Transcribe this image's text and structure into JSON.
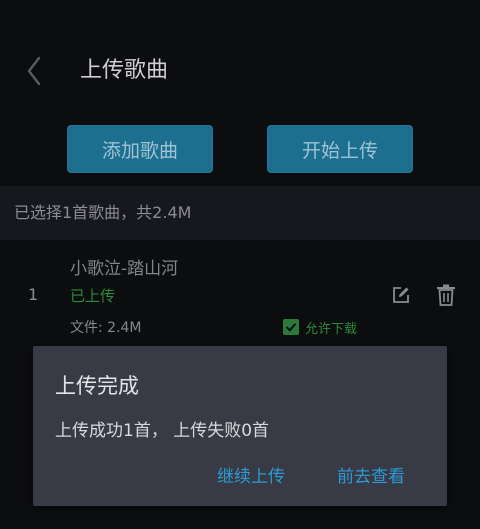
{
  "header": {
    "title": "上传歌曲",
    "back_icon": "chevron-left-icon"
  },
  "actions": {
    "add_label": "添加歌曲",
    "start_label": "开始上传"
  },
  "summary": {
    "text": "已选择1首歌曲，共2.4M"
  },
  "songs": [
    {
      "index": "1",
      "title": "小歌泣-踏山河",
      "status": "已上传",
      "file": "文件: 2.4M",
      "allow_download_label": "允许下载",
      "allow_download": true
    }
  ],
  "dialog": {
    "title": "上传完成",
    "message": "上传成功1首，  上传失败0首",
    "continue_label": "继续上传",
    "view_label": "前去查看"
  },
  "colors": {
    "background": "#0c0d0f",
    "button": "#1d6f8f",
    "accent": "#2d9bd3",
    "success": "#2e8a3a",
    "dialog": "#383a45"
  }
}
